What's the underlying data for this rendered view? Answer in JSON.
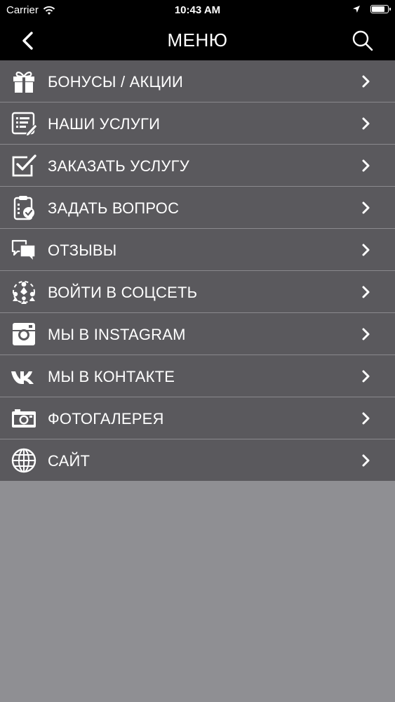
{
  "status_bar": {
    "carrier": "Carrier",
    "time": "10:43 AM",
    "battery_level": 0.9
  },
  "nav": {
    "title": "МЕНЮ",
    "back_icon": "chevron-left-icon",
    "search_icon": "search-icon"
  },
  "menu": {
    "items": [
      {
        "label": "БОНУСЫ / АКЦИИ",
        "icon": "gift-icon"
      },
      {
        "label": "НАШИ УСЛУГИ",
        "icon": "list-edit-icon"
      },
      {
        "label": "ЗАКАЗАТЬ УСЛУГУ",
        "icon": "checkbox-icon"
      },
      {
        "label": "ЗАДАТЬ ВОПРОС",
        "icon": "clipboard-check-icon"
      },
      {
        "label": "ОТЗЫВЫ",
        "icon": "chat-bubbles-icon"
      },
      {
        "label": "ВОЙТИ В СОЦСЕТЬ",
        "icon": "social-network-icon"
      },
      {
        "label": "МЫ В INSTAGRAM",
        "icon": "instagram-icon"
      },
      {
        "label": "МЫ В КОНТАКТЕ",
        "icon": "vk-icon"
      },
      {
        "label": "ФОТОГАЛЕРЕЯ",
        "icon": "camera-icon"
      },
      {
        "label": "САЙТ",
        "icon": "globe-icon"
      }
    ]
  },
  "colors": {
    "bar_background": "#000000",
    "menu_background": "#5a595d",
    "divider": "#8a898d",
    "page_background": "#8f8f93",
    "text": "#ffffff"
  }
}
